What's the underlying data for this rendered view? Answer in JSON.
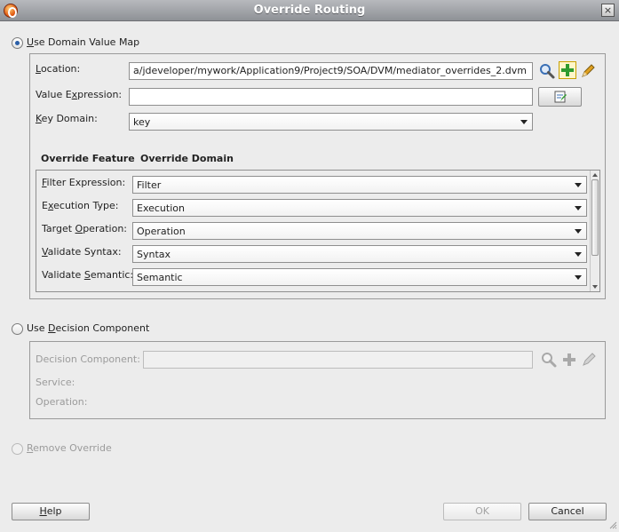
{
  "window": {
    "title": "Override Routing",
    "close_symbol": "×"
  },
  "dvm_option": {
    "label_accel": "U",
    "label_rest": "se Domain Value Map",
    "checked": true,
    "location_accel": "L",
    "location_rest": "ocation:",
    "location_value": "a/jdeveloper/mywork/Application9/Project9/SOA/DVM/mediator_overrides_2.dvm",
    "value_expr_pre": "Value E",
    "value_expr_accel": "x",
    "value_expr_rest": "pression:",
    "value_expr_value": "",
    "key_domain_accel": "K",
    "key_domain_rest": "ey Domain:",
    "key_domain_value": "key",
    "col_feature": "Override Feature",
    "col_domain": "Override Domain",
    "rows": [
      {
        "pre": "",
        "accel": "F",
        "rest": "ilter Expression:",
        "value": "Filter"
      },
      {
        "pre": "E",
        "accel": "x",
        "rest": "ecution Type:",
        "value": "Execution"
      },
      {
        "pre": "Target ",
        "accel": "O",
        "rest": "peration:",
        "value": "Operation"
      },
      {
        "pre": "",
        "accel": "V",
        "rest": "alidate Syntax:",
        "value": "Syntax"
      },
      {
        "pre": "Validate ",
        "accel": "S",
        "rest": "emantic:",
        "value": "Semantic"
      }
    ]
  },
  "decision_option": {
    "label_pre": "Use ",
    "label_accel": "D",
    "label_rest": "ecision Component",
    "checked": false,
    "decision_component_label": "Decision Component:",
    "decision_component_value": "",
    "service_label": "Service:",
    "operation_label": "Operation:"
  },
  "remove_option": {
    "label_accel": "R",
    "label_rest": "emove Override",
    "checked": false
  },
  "buttons": {
    "help_accel": "H",
    "help_rest": "elp",
    "ok": "OK",
    "cancel": "Cancel"
  },
  "colors": {
    "title_bg": "#9fa2a6",
    "add_icon": "#2e9b2e",
    "search_icon": "#3a6fb5",
    "edit_icon": "#e0a020"
  }
}
